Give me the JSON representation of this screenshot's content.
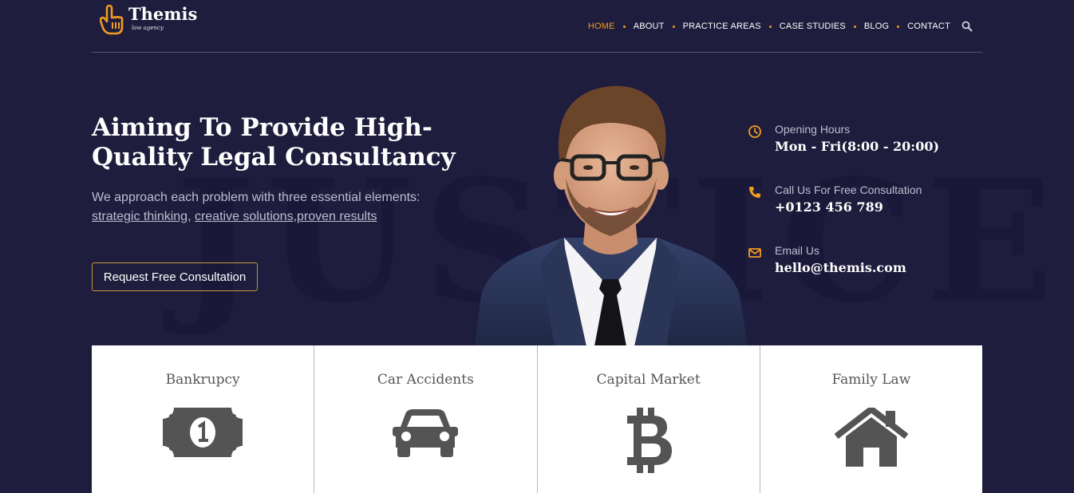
{
  "brand": {
    "name": "Themis",
    "tagline": "law agency"
  },
  "nav": {
    "items": [
      {
        "label": "HOME",
        "active": true
      },
      {
        "label": "ABOUT"
      },
      {
        "label": "PRACTICE AREAS"
      },
      {
        "label": "CASE STUDIES"
      },
      {
        "label": "BLOG"
      },
      {
        "label": "CONTACT"
      }
    ],
    "search_icon": "search-icon"
  },
  "hero": {
    "watermark": "JUSTICE",
    "title": "Aiming To Provide High-Quality Legal Consultancy",
    "lead": "We approach each problem with three essential elements:",
    "links": [
      "strategic thinking",
      "creative solutions",
      "proven results"
    ],
    "cta": "Request Free Consultation"
  },
  "info": [
    {
      "icon": "clock-icon",
      "label": "Opening Hours",
      "value": "Mon - Fri(8:00 - 20:00)"
    },
    {
      "icon": "phone-icon",
      "label": "Call Us For Free Consultation",
      "value": "+0123 456 789"
    },
    {
      "icon": "envelope-icon",
      "label": "Email Us",
      "value": "hello@themis.com"
    }
  ],
  "services": [
    {
      "title": "Bankrupcy",
      "icon": "money-bill-icon"
    },
    {
      "title": "Car Accidents",
      "icon": "car-icon"
    },
    {
      "title": "Capital Market",
      "icon": "bitcoin-icon"
    },
    {
      "title": "Family Law",
      "icon": "home-icon"
    }
  ],
  "colors": {
    "background": "#1f1d3d",
    "accent": "#f29b1e",
    "cta_border": "#c9973f",
    "icon_gray": "#545454"
  }
}
